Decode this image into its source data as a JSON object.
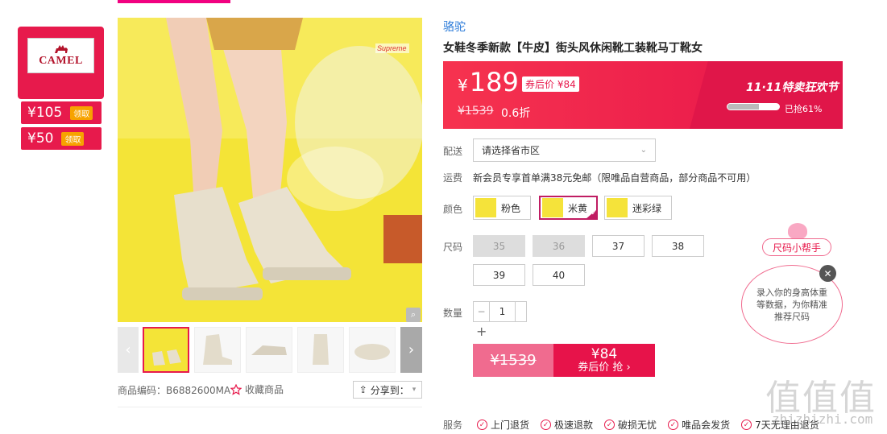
{
  "brand_card": {
    "logo_text": "CAMEL",
    "coupons": [
      {
        "amount": "¥105",
        "action": "领取"
      },
      {
        "amount": "¥50",
        "action": "领取"
      }
    ]
  },
  "gallery": {
    "main_image_label": "Supreme",
    "zoom_icon": "magnifier-icon",
    "thumbnails_count": 5
  },
  "meta": {
    "sku": "商品编码：B6882600MA",
    "favorite": "收藏商品",
    "share": "分享到："
  },
  "product": {
    "brand": "骆驼",
    "title": "女鞋冬季新款【牛皮】街头风休闲靴工装靴马丁靴女"
  },
  "price": {
    "current": "189",
    "currency": "¥",
    "after_coupon": "券后价 ¥84",
    "original": "¥1539",
    "discount": "0.6折",
    "event_title": "11·11特卖狂欢节",
    "sold_text": "已抢61%",
    "sold_fraction": 0.61
  },
  "shipping": {
    "label": "配送",
    "select_placeholder": "请选择省市区",
    "freight_label": "运费",
    "freight_text": "新会员专享首单满38元免邮（限唯品自营商品，部分商品不可用）"
  },
  "colors": {
    "label": "颜色",
    "options": [
      "粉色",
      "米黄",
      "迷彩绿"
    ],
    "selected": "米黄"
  },
  "sizes": {
    "label": "尺码",
    "options": [
      "35",
      "36",
      "37",
      "38",
      "39",
      "40"
    ],
    "disabled": [
      "35",
      "36"
    ]
  },
  "quantity": {
    "label": "数量",
    "value": "1",
    "minus": "−",
    "plus": "+"
  },
  "buy": {
    "original": "¥1539",
    "price": "¥84",
    "action": "券后价 抢 ›"
  },
  "services": {
    "label": "服务",
    "items": [
      "上门退货",
      "极速退款",
      "破损无忧",
      "唯品会发货",
      "7天无理由退货"
    ]
  },
  "size_helper": {
    "tag": "尺码小帮手",
    "text": "录入你的身高体重等数据，为你精准推荐尺码",
    "close": "✕"
  },
  "watermark": {
    "chars": "值值值",
    "url": "zhizhizhi.com"
  },
  "colors_theme": {
    "accent": "#e71a4c",
    "link": "#2a7ad9",
    "selected_border": "#c01d63"
  }
}
